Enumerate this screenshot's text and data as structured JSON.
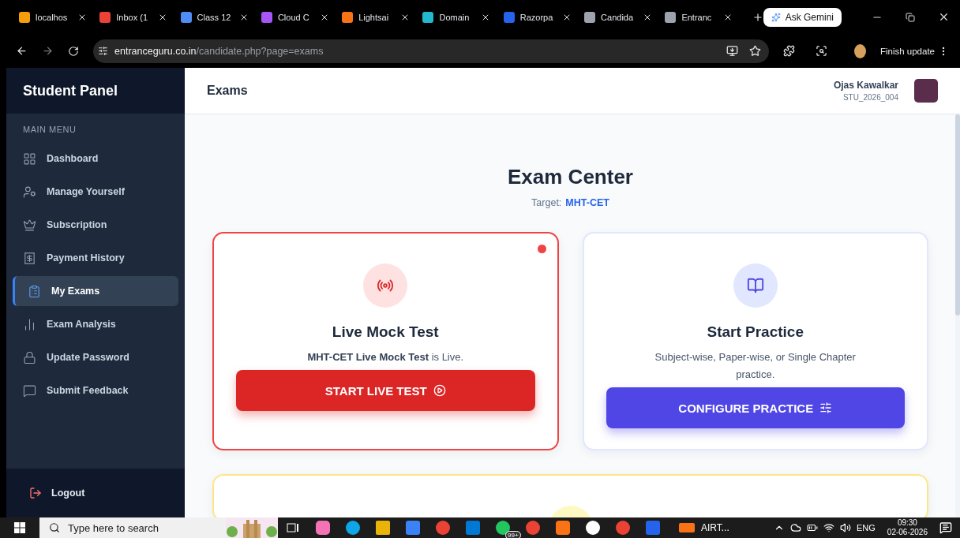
{
  "browser": {
    "tabs": [
      {
        "title": "localhos",
        "color": "#f59e0b"
      },
      {
        "title": "Inbox (1",
        "color": "#ea4335"
      },
      {
        "title": "Class 12",
        "color": "#4f8df5"
      },
      {
        "title": "Cloud C",
        "color": "#a855f7"
      },
      {
        "title": "Lightsai",
        "color": "#f97316"
      },
      {
        "title": "Domain",
        "color": "#22b8cf"
      },
      {
        "title": "Razorpa",
        "color": "#2563eb"
      },
      {
        "title": "Candida",
        "color": "#9ca3af"
      },
      {
        "title": "Entranc",
        "color": "#9ca3af"
      }
    ],
    "ask_button": "Ask Gemini",
    "address_domain": "entranceguru.co.in",
    "address_path": "/candidate.php?page=exams",
    "update_button": "Finish update"
  },
  "sidebar": {
    "title": "Student Panel",
    "section": "MAIN MENU",
    "items": [
      {
        "label": "Dashboard",
        "selected": false
      },
      {
        "label": "Manage Yourself",
        "selected": false
      },
      {
        "label": "Subscription",
        "selected": false
      },
      {
        "label": "Payment History",
        "selected": false
      },
      {
        "label": "My Exams",
        "selected": true
      },
      {
        "label": "Exam Analysis",
        "selected": false
      },
      {
        "label": "Update Password",
        "selected": false
      },
      {
        "label": "Submit Feedback",
        "selected": false
      }
    ],
    "logout": "Logout"
  },
  "header": {
    "title": "Exams",
    "user_name": "Ojas Kawalkar",
    "user_id": "STU_2026_004"
  },
  "main": {
    "heading": "Exam Center",
    "target_label": "Target:",
    "target_value": "MHT-CET",
    "cards": [
      {
        "kind": "live",
        "title": "Live Mock Test",
        "description": "**MHT-CET Live Mock Test** is Live.",
        "button": "START LIVE TEST"
      },
      {
        "kind": "practice",
        "title": "Start Practice",
        "description": "Subject-wise, Paper-wise, or Single Chapter practice.",
        "button": "CONFIGURE PRACTICE"
      },
      {
        "kind": "partial"
      }
    ]
  },
  "taskbar": {
    "search_placeholder": "Type here to search",
    "badge": "99+",
    "app_label": "AIRT...",
    "language": "ENG",
    "time": "09:30",
    "date": "02-06-2026"
  }
}
